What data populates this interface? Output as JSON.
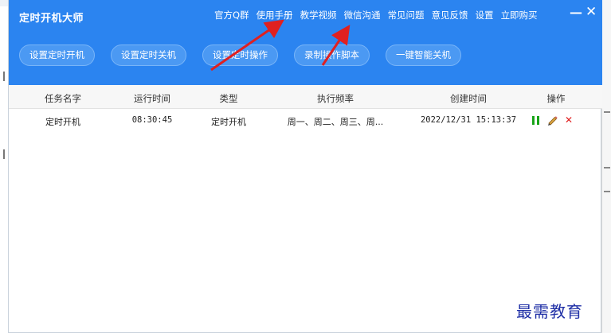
{
  "app": {
    "title": "定时开机大师"
  },
  "topnav": [
    {
      "label": "官方Q群"
    },
    {
      "label": "使用手册"
    },
    {
      "label": "教学视频"
    },
    {
      "label": "微信沟通"
    },
    {
      "label": "常见问题"
    },
    {
      "label": "意见反馈"
    },
    {
      "label": "设置"
    },
    {
      "label": "立即购买"
    }
  ],
  "window_controls": {
    "minimize": "—",
    "close": "✕"
  },
  "toolbar": [
    {
      "label": "设置定时开机"
    },
    {
      "label": "设置定时关机"
    },
    {
      "label": "设置定时操作"
    },
    {
      "label": "录制操作脚本"
    },
    {
      "label": "一键智能关机"
    }
  ],
  "table": {
    "columns": [
      "任务名字",
      "运行时间",
      "类型",
      "执行频率",
      "创建时间",
      "操作"
    ],
    "rows": [
      {
        "name": "定时开机",
        "run_time": "08:30:45",
        "type": "定时开机",
        "frequency": "周一、周二、周三、周...",
        "created": "2022/12/31 15:13:37",
        "actions": [
          "pause-icon",
          "edit-pencil-icon",
          "delete-icon"
        ]
      }
    ]
  },
  "watermark": "最需教育",
  "colors": {
    "header": "#2b84f0",
    "button": "#4b99f3",
    "pause": "#19a519",
    "delete": "#e01b1b",
    "annotation_arrow": "#e02020",
    "watermark": "#1f2fa6"
  }
}
